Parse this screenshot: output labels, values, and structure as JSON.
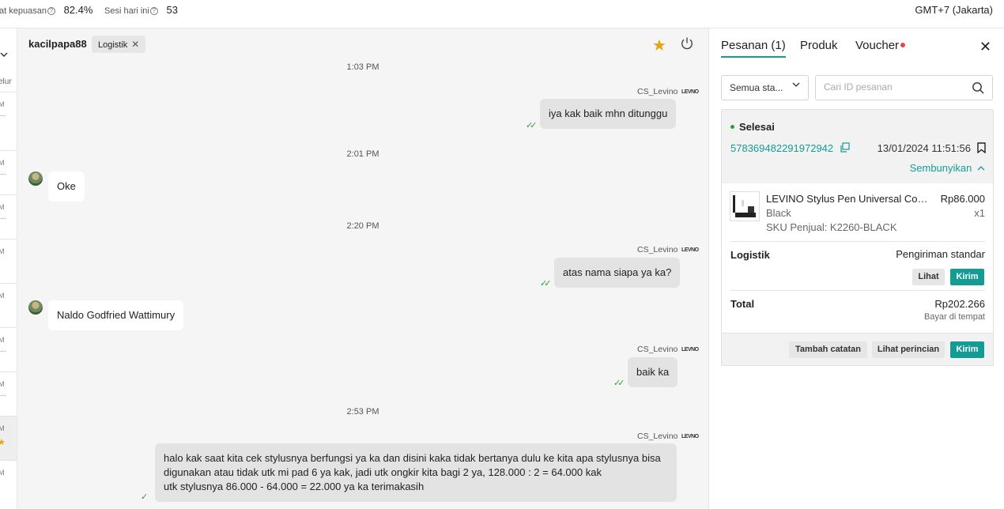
{
  "topbar": {
    "satisfaction_label": "at kepuasan",
    "satisfaction_value": "82.4%",
    "sessions_label": "Sesi hari ini",
    "sessions_value": "53",
    "timezone": "GMT+7 (Jakarta)"
  },
  "sidebar": {
    "search_fragment": "elur",
    "rows": [
      {
        "time": "M",
        "preview": "..."
      },
      {
        "time": "M",
        "preview": "..."
      },
      {
        "time": "M",
        "preview": "..."
      },
      {
        "time": "M",
        "preview": ""
      },
      {
        "time": "M",
        "preview": ""
      },
      {
        "time": "M",
        "preview": "..."
      },
      {
        "time": "M",
        "preview": "..."
      },
      {
        "time": "M",
        "preview": ""
      },
      {
        "time": "M",
        "preview": ""
      }
    ]
  },
  "chat": {
    "username": "kacilpapa88",
    "tag": "Logistik",
    "messages": [
      {
        "type": "time",
        "text": "1:03 PM"
      },
      {
        "type": "out",
        "sender": "CS_Levino",
        "text": "iya kak baik mhn ditunggu"
      },
      {
        "type": "time",
        "text": "2:01 PM"
      },
      {
        "type": "in",
        "text": "Oke"
      },
      {
        "type": "time",
        "text": "2:20 PM"
      },
      {
        "type": "out",
        "sender": "CS_Levino",
        "text": "atas nama siapa ya ka?"
      },
      {
        "type": "in",
        "text": "Naldo Godfried Wattimury"
      },
      {
        "type": "out",
        "sender": "CS_Levino",
        "text": "baik ka"
      },
      {
        "type": "time",
        "text": "2:53 PM"
      },
      {
        "type": "out",
        "sender": "CS_Levino",
        "lines": [
          "halo kak saat kita cek stylusnya berfungsi ya ka dan disini kaka tidak bertanya dulu ke kita apa stylusnya bisa",
          "digunakan atau tidak utk mi pad 6 ya kak, jadi utk ongkir kita bagi 2 ya, 128.000 : 2 = 64.000 kak",
          "utk stylusnya 86.000 - 64.000 = 22.000 ya ka terimakasih"
        ]
      }
    ],
    "logo_text": "LEVNO"
  },
  "panel": {
    "tabs": [
      "Pesanan (1)",
      "Produk",
      "Voucher"
    ],
    "filter_label": "Semua sta...",
    "search_placeholder": "Cari ID pesanan",
    "order": {
      "status": "Selesai",
      "id": "578369482291972942",
      "date": "13/01/2024 11:51:56",
      "hide_label": "Sembunyikan",
      "product_name": "LEVINO Stylus Pen Universal Com...",
      "product_price": "Rp86.000",
      "variant": "Black",
      "qty": "x1",
      "sku": "SKU Penjual: K2260-BLACK",
      "logistics_label": "Logistik",
      "logistics_value": "Pengiriman standar",
      "view_btn": "Lihat",
      "send_btn": "Kirim",
      "total_label": "Total",
      "total_value": "Rp202.266",
      "payment": "Bayar di tempat",
      "add_note_btn": "Tambah catatan",
      "detail_btn": "Lihat perincian",
      "send_btn2": "Kirim"
    }
  },
  "colors": {
    "accent": "#139b94",
    "star": "#e6a312",
    "tick": "#27a33c"
  }
}
